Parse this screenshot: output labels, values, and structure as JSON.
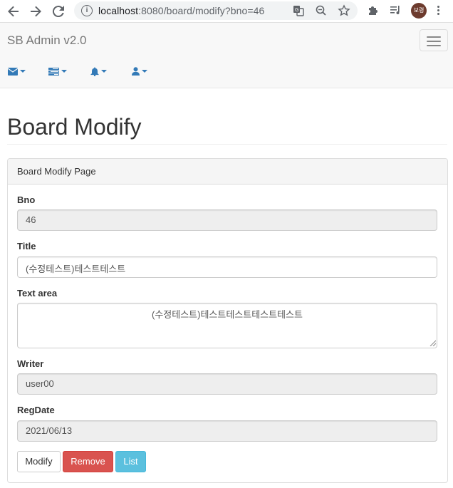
{
  "browser": {
    "url_host": "localhost",
    "url_rest": ":8080/board/modify?bno=46",
    "profile_label": "보령"
  },
  "navbar": {
    "brand": "SB Admin v2.0",
    "dropdowns": [
      {
        "icon": "envelope-icon"
      },
      {
        "icon": "tasks-icon"
      },
      {
        "icon": "bell-icon"
      },
      {
        "icon": "user-icon"
      }
    ]
  },
  "page": {
    "title": "Board Modify"
  },
  "panel": {
    "heading": "Board Modify Page"
  },
  "form": {
    "bno_label": "Bno",
    "bno_value": "46",
    "title_label": "Title",
    "title_value": "(수정테스트)테스트테스트",
    "content_label": "Text area",
    "content_value": "(수정테스트)테스트테스트테스트테스트",
    "writer_label": "Writer",
    "writer_value": "user00",
    "regdate_label": "RegDate",
    "regdate_value": "2021/06/13"
  },
  "buttons": {
    "modify": "Modify",
    "remove": "Remove",
    "list": "List"
  },
  "colors": {
    "link": "#337ab7",
    "danger": "#d9534f",
    "info": "#5bc0de"
  }
}
